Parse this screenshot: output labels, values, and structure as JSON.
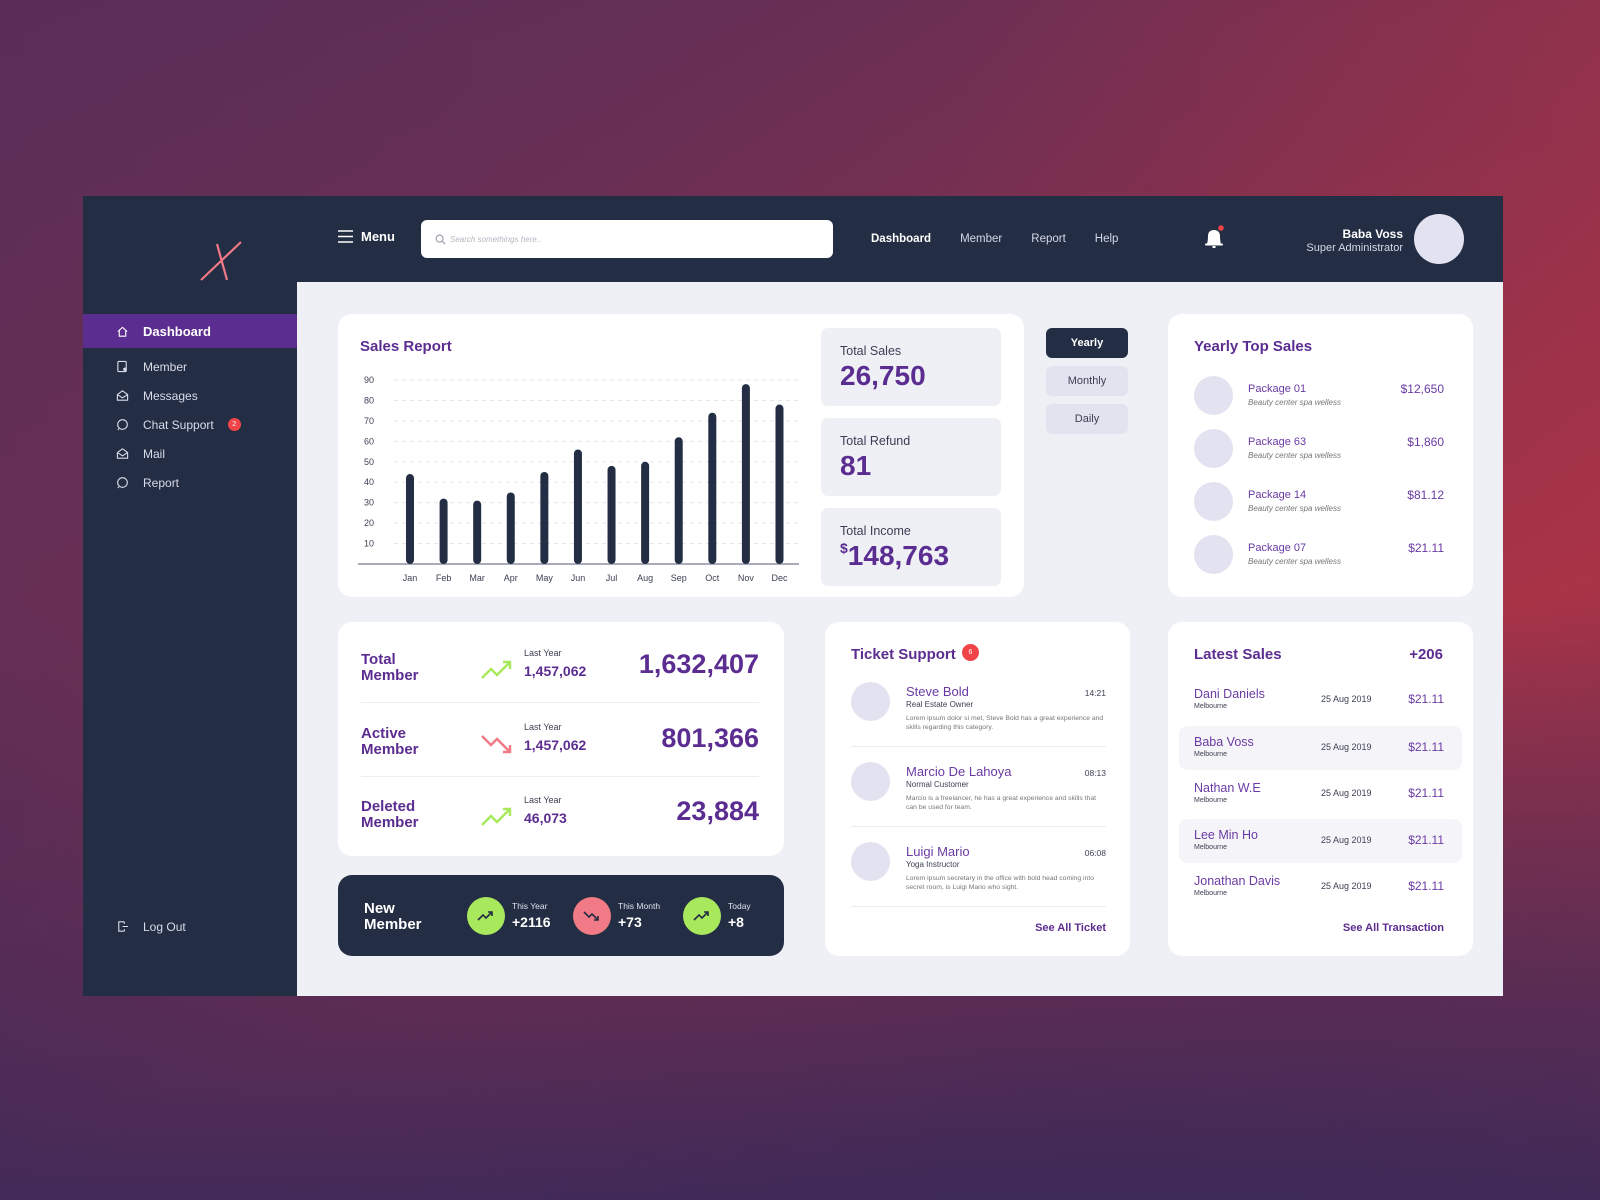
{
  "colors": {
    "brand_purple": "#5c2d91",
    "dark_navy": "#232d43",
    "accent_pink": "#f07a86",
    "trend_up": "#a7e85d",
    "trend_down": "#f07a86",
    "badge_red": "#f04448"
  },
  "logo": {
    "letter": "X"
  },
  "sidebar": {
    "items": [
      {
        "label": "Dashboard",
        "icon": "home-icon",
        "active": true
      },
      {
        "label": "Member",
        "icon": "member-icon"
      },
      {
        "label": "Messages",
        "icon": "messages-icon"
      },
      {
        "label": "Chat Support",
        "icon": "chat-icon",
        "badge": "2"
      },
      {
        "label": "Mail",
        "icon": "mail-icon"
      },
      {
        "label": "Report",
        "icon": "report-icon"
      }
    ],
    "logout_label": "Log Out"
  },
  "topbar": {
    "menu_label": "Menu",
    "search_placeholder": "Search somethings here..",
    "nav": [
      {
        "label": "Dashboard",
        "active": true
      },
      {
        "label": "Member"
      },
      {
        "label": "Report"
      },
      {
        "label": "Help"
      }
    ],
    "user": {
      "name": "Baba Voss",
      "role": "Super Administrator"
    }
  },
  "sales_report": {
    "title": "Sales Report",
    "stats": [
      {
        "label": "Total Sales",
        "value": "26,750"
      },
      {
        "label": "Total Refund",
        "value": "81"
      },
      {
        "label": "Total Income",
        "currency": "$",
        "value": "148,763"
      }
    ],
    "periods": [
      {
        "label": "Yearly",
        "active": true
      },
      {
        "label": "Monthly"
      },
      {
        "label": "Daily"
      }
    ]
  },
  "chart_data": {
    "type": "bar",
    "title": "Sales Report",
    "categories": [
      "Jan",
      "Feb",
      "Mar",
      "Apr",
      "May",
      "Jun",
      "Jul",
      "Aug",
      "Sep",
      "Oct",
      "Nov",
      "Dec"
    ],
    "values": [
      44,
      32,
      31,
      35,
      45,
      56,
      48,
      50,
      62,
      74,
      88,
      78
    ],
    "yticks": [
      10,
      20,
      30,
      40,
      50,
      60,
      70,
      80,
      90
    ],
    "ylim": [
      0,
      90
    ],
    "xlabel": "",
    "ylabel": "",
    "grid": true,
    "legend": "none"
  },
  "top_sales": {
    "title": "Yearly Top Sales",
    "items": [
      {
        "name": "Package 01",
        "desc": "Beauty center spa welless",
        "value": "$12,650"
      },
      {
        "name": "Package 63",
        "desc": "Beauty center spa welless",
        "value": "$1,860"
      },
      {
        "name": "Package 14",
        "desc": "Beauty center spa welless",
        "value": "$81.12"
      },
      {
        "name": "Package 07",
        "desc": "Beauty center spa welless",
        "value": "$21.11"
      }
    ]
  },
  "members": {
    "rows": [
      {
        "label_line1": "Total",
        "label_line2": "Member",
        "trend": "up",
        "last_year_label": "Last Year",
        "last_year": "1,457,062",
        "value": "1,632,407"
      },
      {
        "label_line1": "Active",
        "label_line2": "Member",
        "trend": "down",
        "last_year_label": "Last Year",
        "last_year": "1,457,062",
        "value": "801,366"
      },
      {
        "label_line1": "Deleted",
        "label_line2": "Member",
        "trend": "up",
        "last_year_label": "Last Year",
        "last_year": "46,073",
        "value": "23,884"
      }
    ]
  },
  "new_member": {
    "label_line1": "New",
    "label_line2": "Member",
    "items": [
      {
        "label": "This Year",
        "value": "+2116",
        "trend": "up"
      },
      {
        "label": "This Month",
        "value": "+73",
        "trend": "down"
      },
      {
        "label": "Today",
        "value": "+8",
        "trend": "up"
      }
    ]
  },
  "tickets": {
    "title": "Ticket Support",
    "badge": "6",
    "items": [
      {
        "name": "Steve Bold",
        "role": "Real Estate Owner",
        "time": "14:21",
        "message": "Lorem ipsum dolor si met, Steve Bold has a great experience and skills regarding this category."
      },
      {
        "name": "Marcio De Lahoya",
        "role": "Normal Customer",
        "time": "08:13",
        "message": "Marcio is a freelancer, he has a great experience and skills that can be used for team."
      },
      {
        "name": "Luigi Mario",
        "role": "Yoga Instructor",
        "time": "06:08",
        "message": "Lorem ipsum secretary in the office with bold head coming into secret room, is Luigi Mario who sight."
      }
    ],
    "see_all": "See All Ticket"
  },
  "latest_sales": {
    "title": "Latest Sales",
    "count": "+206",
    "items": [
      {
        "name": "Dani Daniels",
        "city": "Melbourne",
        "date": "25 Aug 2019",
        "value": "$21.11"
      },
      {
        "name": "Baba Voss",
        "city": "Melbourne",
        "date": "25 Aug 2019",
        "value": "$21.11"
      },
      {
        "name": "Nathan W.E",
        "city": "Melbourne",
        "date": "25 Aug 2019",
        "value": "$21.11"
      },
      {
        "name": "Lee Min Ho",
        "city": "Melbourne",
        "date": "25 Aug 2019",
        "value": "$21.11"
      },
      {
        "name": "Jonathan Davis",
        "city": "Melbourne",
        "date": "25 Aug 2019",
        "value": "$21.11"
      }
    ],
    "see_all": "See All Transaction"
  }
}
